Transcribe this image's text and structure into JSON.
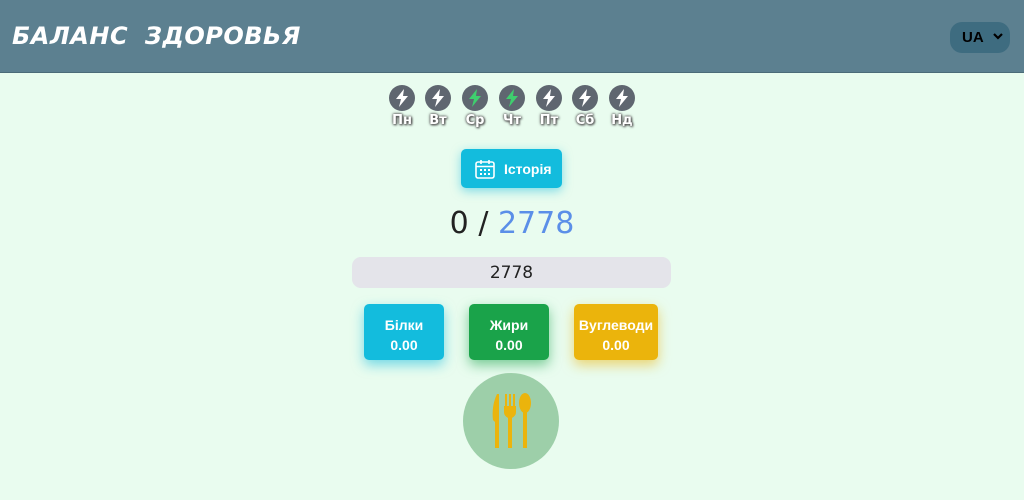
{
  "header": {
    "title": "БАЛАНС  ЗДОРОВЬЯ",
    "language": "UA"
  },
  "week": {
    "days": [
      {
        "label": "Пн",
        "active": false
      },
      {
        "label": "Вт",
        "active": false
      },
      {
        "label": "Ср",
        "active": true
      },
      {
        "label": "Чт",
        "active": true
      },
      {
        "label": "Пт",
        "active": false
      },
      {
        "label": "Сб",
        "active": false
      },
      {
        "label": "Нд",
        "active": false
      }
    ]
  },
  "history": {
    "label": "Історія"
  },
  "calories": {
    "consumed": "0",
    "separator": "/",
    "target": "2778",
    "input_value": "2778"
  },
  "macros": {
    "protein": {
      "label": "Білки",
      "value": "0.00"
    },
    "fat": {
      "label": "Жири",
      "value": "0.00"
    },
    "carbs": {
      "label": "Вуглеводи",
      "value": "0.00"
    }
  },
  "colors": {
    "header": "#5c8090",
    "background": "#e9fcef",
    "active_bolt": "#3fcf6e",
    "inactive_bolt": "#5f6670",
    "history_button": "#13bcdd",
    "protein": "#13bcdd",
    "fat": "#1aa34a",
    "carbs": "#ebb40c",
    "food_circle": "#9dcfa9",
    "cutlery": "#ebb40c"
  },
  "icons": {
    "day": "lightning-bolt-icon",
    "history": "calendar-icon",
    "language": "chevron-down-icon",
    "food": "cutlery-icon"
  }
}
